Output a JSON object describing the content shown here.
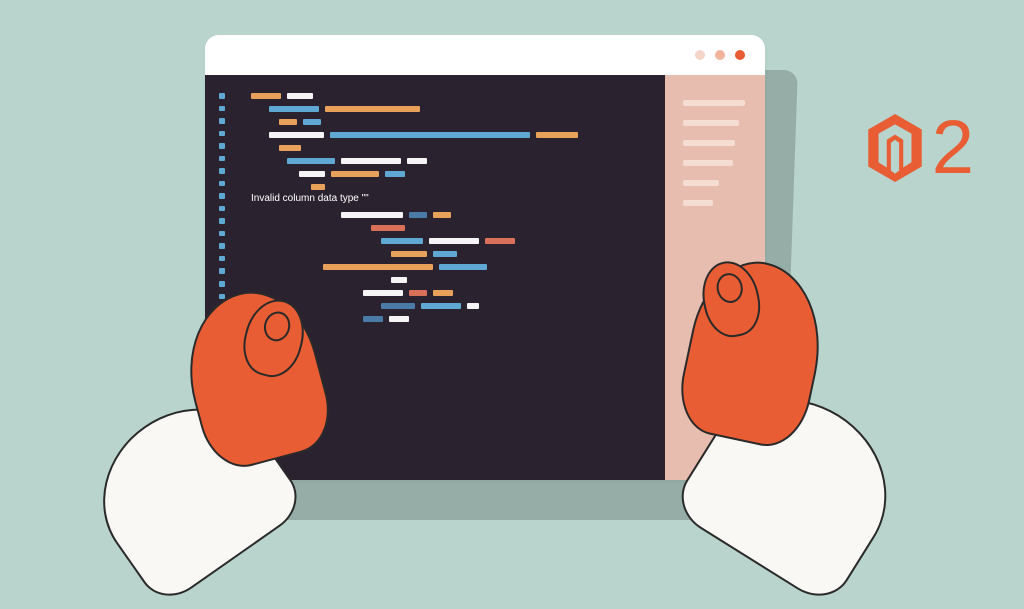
{
  "editor": {
    "error_text": "Invalid column data type \"\""
  },
  "logo": {
    "version": "2"
  },
  "colors": {
    "accent": "#e85d33",
    "bg": "#b8d4cc",
    "editor_bg": "#2b2230",
    "minimap_bg": "#e7bdb0"
  }
}
